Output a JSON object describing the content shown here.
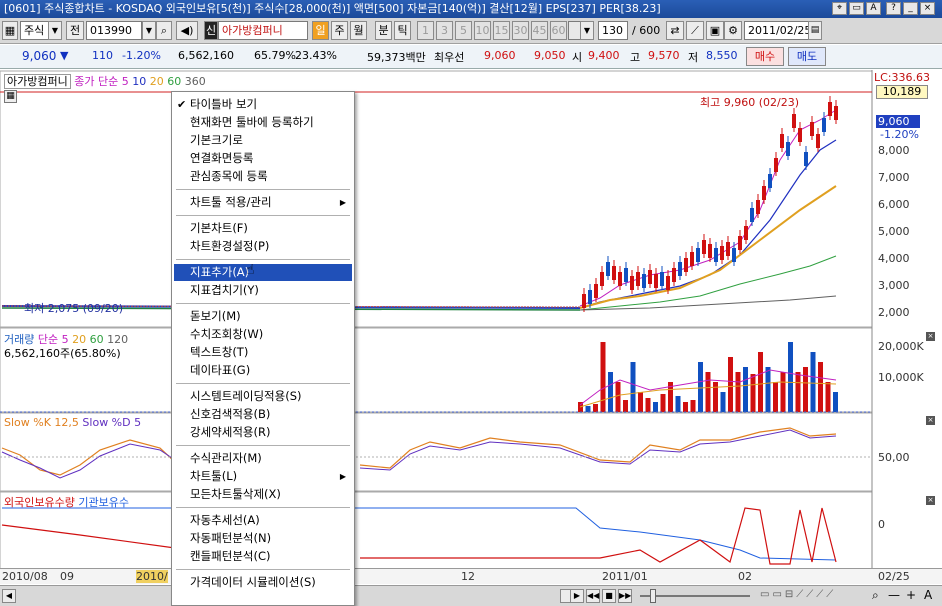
{
  "title": "[0601] 주식종합차트 - KOSDAQ 외국인보유[5(천)] 주식수[28,000(천)] 액면[500] 자본금[140(억)] 결산[12월] EPS[237] PER[38.23]",
  "toolbar": {
    "market": "주식",
    "prefix": "전",
    "code": "013990",
    "name_badge": "신",
    "stock_name": "아가방컴퍼니",
    "period_buttons": [
      "일",
      "주",
      "월",
      "분",
      "틱"
    ],
    "minute_buttons": [
      "1",
      "3",
      "5",
      "10",
      "15",
      "30",
      "45",
      "60"
    ],
    "count": "130",
    "total": "/ 600",
    "date": "2011/02/25"
  },
  "quote": {
    "price": "9,060",
    "change": "110",
    "change_pct": "-1.20%",
    "volume": "6,562,160",
    "vol_ratio": "65.79%",
    "turnover": "23.43%",
    "amount": "59,373백만",
    "pref_label": "최우선",
    "ask": "9,060",
    "bid": "9,050",
    "open_label": "시",
    "open": "9,400",
    "high_label": "고",
    "high": "9,570",
    "low_label": "저",
    "low": "8,550",
    "buy_label": "매수",
    "sell_label": "매도"
  },
  "price_legend": {
    "name": "아가방컴퍼니",
    "indicator": "종가 단순 5",
    "periods": [
      "10",
      "20",
      "60",
      "360"
    ]
  },
  "annotations": {
    "high": "최고 9,960 (02/23)",
    "low": "최저 2,075 (09/20)",
    "lc": "LC:336.63",
    "last_price": "9,060",
    "last_pct": "-1.20%",
    "top_price": "10,189"
  },
  "volume_legend": {
    "name": "거래량",
    "indicator": "단순 5",
    "periods": [
      "20",
      "60",
      "120"
    ],
    "value": "6,562,160주(65.80%)"
  },
  "slow_legend": {
    "k": "Slow %K 12,5",
    "d": "Slow %D 5"
  },
  "foreign_legend": {
    "a": "외국인보유수량",
    "b": "기관보유수"
  },
  "price_axis": [
    "8,000",
    "7,000",
    "6,000",
    "5,000",
    "4,000",
    "3,000",
    "2,000"
  ],
  "volume_axis": [
    "20,000K",
    "10,000K"
  ],
  "slow_axis": [
    "50,00"
  ],
  "foreign_axis": [
    "0"
  ],
  "date_axis": [
    "2010/08",
    "09",
    "2010/",
    "12",
    "2011/01",
    "02",
    "02/25"
  ],
  "menu": [
    {
      "label": "타이틀바 보기",
      "checked": true
    },
    {
      "label": "현재화면 툴바에 등록하기"
    },
    {
      "label": "기본크기로"
    },
    {
      "label": "연결화면등록"
    },
    {
      "label": "관심종목에 등록"
    },
    {
      "sep": true
    },
    {
      "label": "차트툴 적용/관리",
      "submenu": true
    },
    {
      "sep": true
    },
    {
      "label": "기본차트(F)"
    },
    {
      "label": "차트환경설정(P)"
    },
    {
      "sep": true
    },
    {
      "label": "지표추가(A)",
      "highlight": true
    },
    {
      "label": "지표겹치기(Y)"
    },
    {
      "sep": true
    },
    {
      "label": "돋보기(M)"
    },
    {
      "label": "수치조회창(W)"
    },
    {
      "label": "텍스트창(T)"
    },
    {
      "label": "데이타표(G)"
    },
    {
      "sep": true
    },
    {
      "label": "시스템트레이딩적용(S)"
    },
    {
      "label": "신호검색적용(B)"
    },
    {
      "label": "강세약세적용(R)"
    },
    {
      "sep": true
    },
    {
      "label": "수식관리자(M)"
    },
    {
      "label": "차트툴(L)",
      "submenu": true
    },
    {
      "label": "모든차트툴삭제(X)"
    },
    {
      "sep": true
    },
    {
      "label": "자동추세선(A)"
    },
    {
      "label": "자동패턴분석(N)"
    },
    {
      "label": "캔들패턴분석(C)"
    },
    {
      "sep": true
    },
    {
      "label": "가격데이터 시뮬레이션(S)"
    }
  ],
  "colors": {
    "title_bg": "#1c4a9a",
    "menu_highlight": "#2050b8",
    "up": "#d01010",
    "down": "#1050c0"
  }
}
